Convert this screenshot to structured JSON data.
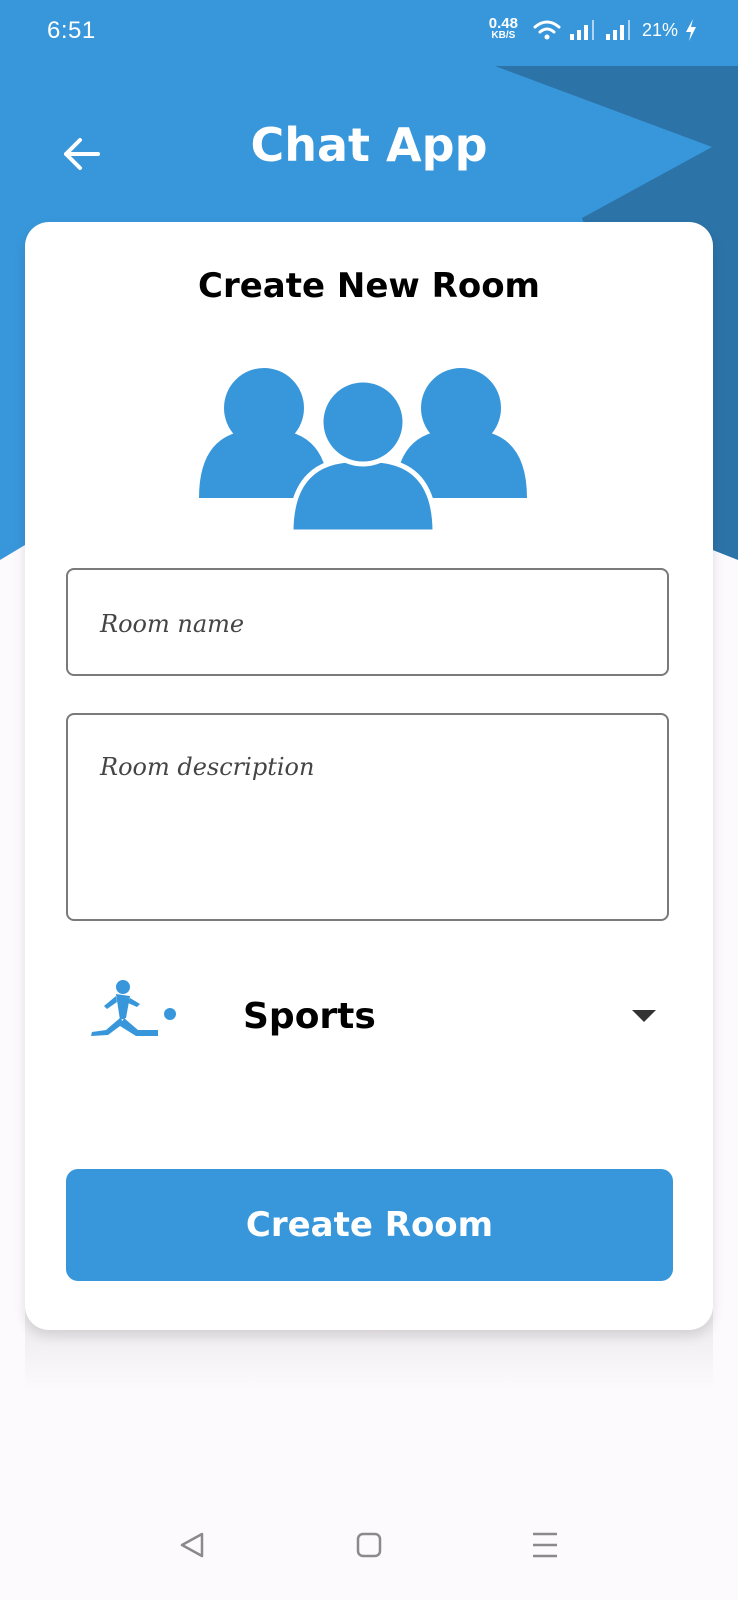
{
  "status_bar": {
    "time": "6:51",
    "net_speed_value": "0.48",
    "net_speed_unit": "KB/S",
    "battery": "21%"
  },
  "app_bar": {
    "title": "Chat App"
  },
  "form": {
    "title": "Create New Room",
    "room_name_placeholder": "Room name",
    "room_description_placeholder": "Room description",
    "category": "Sports",
    "submit_label": "Create Room"
  },
  "colors": {
    "primary": "#3897db",
    "primary_dark": "#2c73a8",
    "background": "#fdfafe",
    "card": "#ffffff"
  },
  "icons": {
    "back": "arrow-left-icon",
    "group": "group-people-icon",
    "category": "soccer-player-icon",
    "dropdown": "triangle-down-icon",
    "nav_back": "nav-triangle-back-icon",
    "nav_home": "nav-square-home-icon",
    "nav_menu": "nav-lines-menu-icon"
  }
}
